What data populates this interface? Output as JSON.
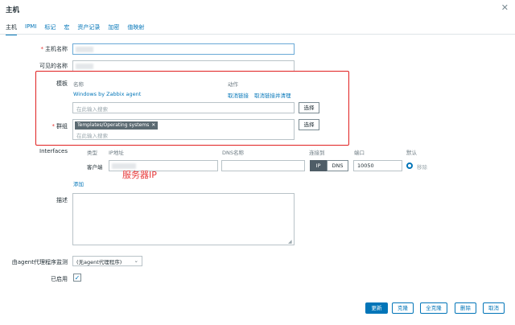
{
  "dialog": {
    "title": "主机",
    "close_icon": "close-icon"
  },
  "tabs": [
    {
      "label": "主机",
      "active": true
    },
    {
      "label": "IPMI"
    },
    {
      "label": "标记"
    },
    {
      "label": "宏"
    },
    {
      "label": "资产记录"
    },
    {
      "label": "加密"
    },
    {
      "label": "值映射"
    }
  ],
  "form": {
    "host_name_label": "主机名称",
    "visible_name_label": "可见的名称",
    "templates": {
      "label": "模板",
      "col_name": "名称",
      "col_action": "动作",
      "linked_name": "Windows by Zabbix agent",
      "unlink": "取消链接",
      "unlink_clear": "取消链接并清理",
      "search_placeholder": "在此输入搜索",
      "select_button": "选择"
    },
    "groups": {
      "label": "群组",
      "chip": "Templates/Operating systems",
      "chip_remove": "✕",
      "search_placeholder": "在此输入搜索",
      "select_button": "选择"
    },
    "interfaces": {
      "label": "Interfaces",
      "col_type": "类型",
      "col_ip": "IP地址",
      "col_dns": "DNS名称",
      "col_connect": "连接到",
      "col_port": "端口",
      "col_default": "默认",
      "row_type": "客户端",
      "ip_on": "IP",
      "dns_off": "DNS",
      "port": "10050",
      "remove": "移除",
      "add": "添加"
    },
    "annotation": "服务器IP",
    "description_label": "描述",
    "proxy_label": "由agent代理程序监测",
    "proxy_value": "(无agent代理程序)",
    "enabled_label": "已启用",
    "enabled_check": "✓"
  },
  "buttons": {
    "update": "更新",
    "clone": "克隆",
    "full_clone": "全克隆",
    "delete": "删除",
    "cancel": "取消"
  },
  "colors": {
    "accent": "#0275b8",
    "highlight_box": "#e02020"
  }
}
